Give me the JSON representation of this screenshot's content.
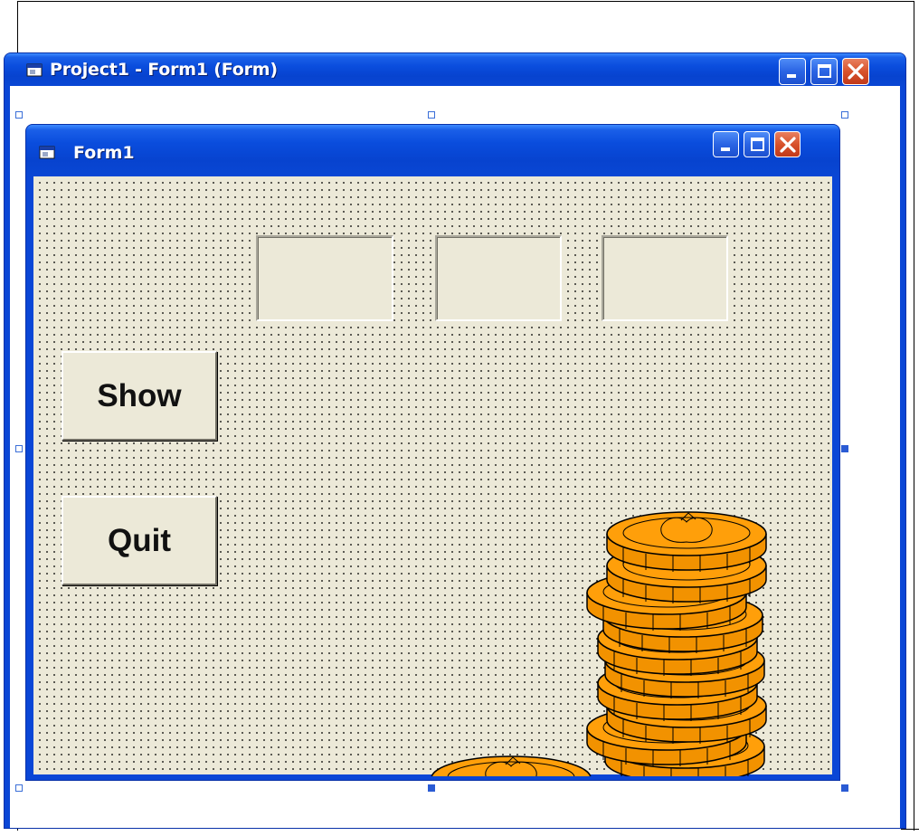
{
  "project_window": {
    "title": "Project1 - Form1 (Form)",
    "icon": "vb-form-icon",
    "controls": [
      "minimize-icon",
      "maximize-icon",
      "close-icon"
    ]
  },
  "form_window": {
    "title": "Form1",
    "icon": "vb-form-icon",
    "controls": [
      "minimize-icon",
      "maximize-icon",
      "close-icon"
    ],
    "labels": [
      {
        "text": ""
      },
      {
        "text": ""
      },
      {
        "text": ""
      }
    ],
    "buttons": {
      "show_label": "Show",
      "quit_label": "Quit"
    },
    "image": "gold-coin-stacks"
  },
  "colors": {
    "titlebar": "#0a4ddd",
    "form_background": "#ece9d8",
    "coin_fill": "#ff9900",
    "close_button": "#d8522c"
  }
}
